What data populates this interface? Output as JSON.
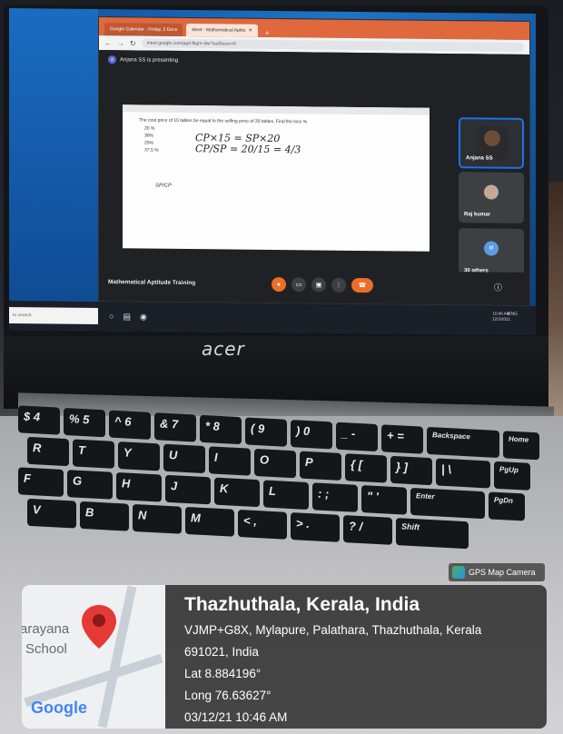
{
  "browser": {
    "tabs": [
      {
        "label": "Google Calendar - Friday, 3 Dece",
        "active": false
      },
      {
        "label": "Meet - Mathematical Aptitu",
        "active": true
      }
    ],
    "url": "meet.google.com/pgd-fkgm-dwr?authuser=0"
  },
  "meet": {
    "presenter_initial": "A",
    "presenting_text": "Anjana SS is presenting",
    "meeting_title": "Mathematical Aptitude Training",
    "participants": [
      {
        "name": "Anjana SS"
      },
      {
        "name": "Raj kumar"
      },
      {
        "name": "30 others",
        "initial": "M"
      }
    ],
    "slide": {
      "question": "The cost price of 15 tables be equal to the selling price of 20 tables. Find the loss %",
      "options": [
        "20 %",
        "30%",
        "25%",
        "37.5 %"
      ],
      "work_line1": "CP×15 = SP×20",
      "work_line2": "CP/SP = 20/15 = 4/3",
      "side_note": "SP/CP"
    }
  },
  "taskbar": {
    "search_placeholder": "to search",
    "time": "10:46 AM",
    "date": "12/3/2021",
    "lang": "ENG"
  },
  "laptop_brand": "acer",
  "keyboard": {
    "row1": [
      "$ 4",
      "% 5",
      "^ 6",
      "& 7",
      "* 8",
      "( 9",
      ") 0",
      "_ -",
      "+ =",
      "Backspace",
      "Home"
    ],
    "row2": [
      "R",
      "T",
      "Y",
      "U",
      "I",
      "O",
      "P",
      "{ [",
      "} ]",
      "| \\",
      "PgUp"
    ],
    "row3": [
      "F",
      "G",
      "H",
      "J",
      "K",
      "L",
      ": ;",
      "\" '",
      "Enter",
      "PgDn"
    ],
    "row4": [
      "V",
      "B",
      "N",
      "M",
      "< ,",
      "> .",
      "? /",
      "Shift"
    ]
  },
  "gps": {
    "app_label": "GPS Map Camera",
    "place": "Thazhuthala, Kerala, India",
    "address_line1": "VJMP+G8X, Mylapure, Palathara, Thazhuthala, Kerala",
    "address_line2": "691021, India",
    "lat": "Lat 8.884196°",
    "long": "Long 76.63627°",
    "datetime": "03/12/21 10:46 AM",
    "map_label_1": "arayana",
    "map_label_2": "School",
    "map_brand": "Google"
  }
}
